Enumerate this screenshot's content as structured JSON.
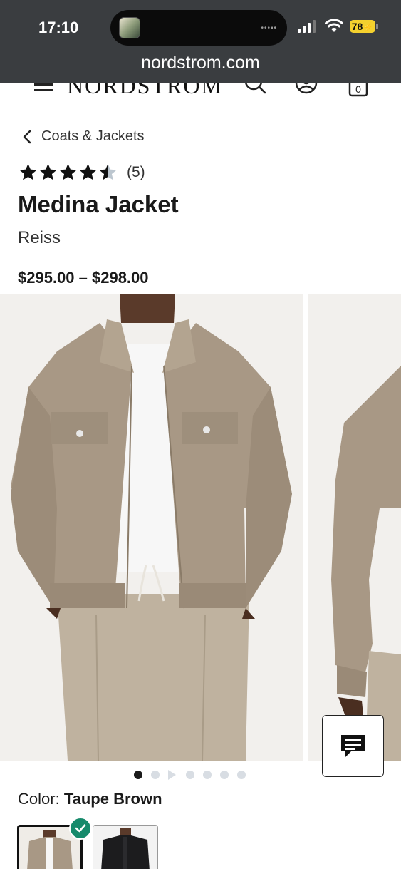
{
  "status_bar": {
    "time": "17:10",
    "battery": "78",
    "url": "nordstrom.com"
  },
  "header": {
    "logo": "NORDSTROM",
    "icons": [
      "menu-icon",
      "search-icon",
      "account-icon",
      "bag-icon"
    ],
    "bag_count": "0"
  },
  "breadcrumb": {
    "label": "Coats & Jackets"
  },
  "product": {
    "rating_stars": 4.5,
    "review_count": "(5)",
    "title": "Medina Jacket",
    "brand": "Reiss",
    "price": "$295.00 – $298.00"
  },
  "gallery": {
    "image_count": 7,
    "active_index": 0
  },
  "color": {
    "label": "Color:",
    "selected": "Taupe Brown",
    "swatches": [
      "Taupe Brown",
      "Black"
    ]
  },
  "colors": {
    "status_bar_bg": "#3a3d40",
    "check_green": "#168a6b",
    "battery_yellow": "#f4d12e"
  }
}
